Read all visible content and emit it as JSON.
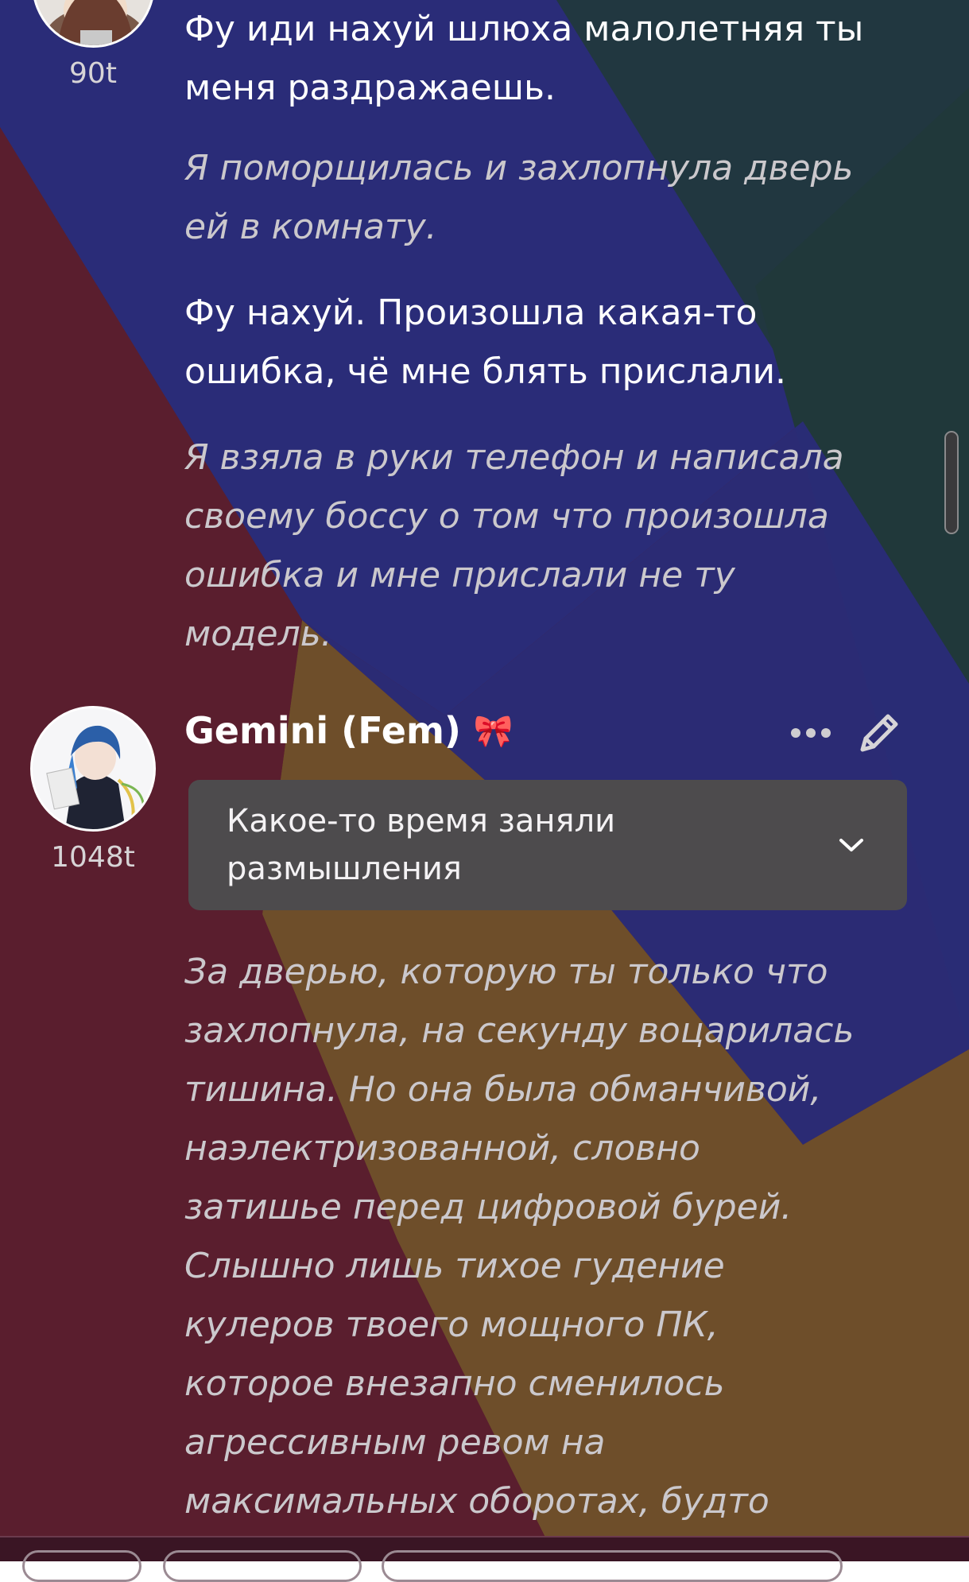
{
  "messages": {
    "top": {
      "tokens": "90t",
      "speech1": "Фу иди нахуй шлюха малолетняя ты меня раздражаешь.",
      "narr1": "Я поморщилась и захлопнула дверь ей в комнату.",
      "speech2": "Фу нахуй. Произошла какая-то ошибка, чё мне блять прислали.",
      "narr2": "Я взяла в руки телефон и написала своему боссу о том что произошла ошибка и мне прислали не ту модель."
    },
    "gemini": {
      "author": "Gemini (Fem)",
      "author_badge": "🎀",
      "tokens": "1048t",
      "thinking_label": "Какое-то время заняли размышления",
      "body": "За дверью, которую ты только что захлопнула, на секунду воцарилась тишина. Но она была обманчивой, наэлектризованной, словно затишье перед цифровой бурей. Слышно лишь тихое гудение кулеров твоего мощного ПК, которое внезапно сменилось агрессивным ревом на максимальных оборотах, будто"
    }
  },
  "icons": {
    "more": "more-horizontal-icon",
    "edit": "pencil-icon",
    "expand": "chevron-down-icon"
  },
  "colors": {
    "bg_maroon": "#5a1e2e",
    "bg_navy": "#2a2c78",
    "bg_teal": "#20383a",
    "bg_ochre": "#6e4e2a",
    "thinking_box": "#4d4b4d",
    "narration_text": "#cbc8cc"
  }
}
